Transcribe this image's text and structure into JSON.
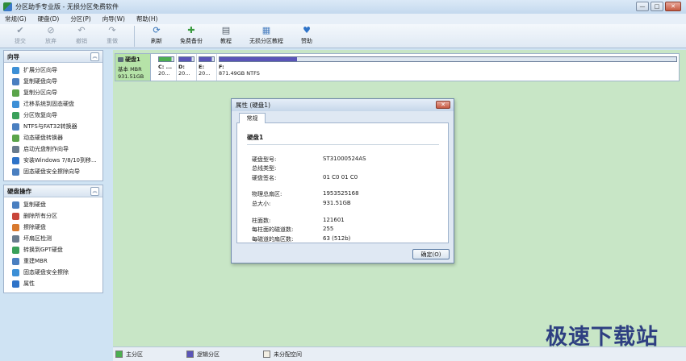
{
  "window": {
    "title": "分区助手专业版 - 无损分区免费软件",
    "buttons": [
      "—",
      "□",
      "✕"
    ]
  },
  "menu": [
    "常规(G)",
    "硬盘(D)",
    "分区(P)",
    "向导(W)",
    "帮助(H)"
  ],
  "toolbar": {
    "group1": [
      {
        "label": "提交",
        "icon": "check-icon",
        "glyph": "✔",
        "disabled": true
      },
      {
        "label": "放弃",
        "icon": "discard-icon",
        "glyph": "⊘",
        "disabled": true
      },
      {
        "label": "撤销",
        "icon": "undo-icon",
        "glyph": "↶",
        "disabled": true
      },
      {
        "label": "重做",
        "icon": "redo-icon",
        "glyph": "↷",
        "disabled": true
      }
    ],
    "group2": [
      {
        "label": "刷新",
        "icon": "refresh-icon",
        "glyph": "⟳",
        "color": "#2f6fb7"
      },
      {
        "label": "免费备份",
        "icon": "backup-icon",
        "glyph": "✚",
        "color": "#3a9a3f"
      },
      {
        "label": "教程",
        "icon": "tutorial-icon",
        "glyph": "▤",
        "color": "#555f6b"
      },
      {
        "label": "无损分区教程",
        "icon": "video-tutorial-icon",
        "glyph": "▦",
        "color": "#4a7fc0"
      },
      {
        "label": "赞助",
        "icon": "heart-icon",
        "glyph": "♥",
        "color": "#2e73c8"
      }
    ]
  },
  "wizard_panel": {
    "title": "向导",
    "items": [
      {
        "label": "扩展分区向导",
        "color": "#3c8fd6"
      },
      {
        "label": "复制硬盘向导",
        "color": "#4a7fc0"
      },
      {
        "label": "复制分区向导",
        "color": "#5aa44a"
      },
      {
        "label": "迁移系统到固态硬盘",
        "color": "#3c8fd6"
      },
      {
        "label": "分区恢复向导",
        "color": "#3aa05a"
      },
      {
        "label": "NTFS与FAT32转换器",
        "color": "#4a7fc0"
      },
      {
        "label": "动态硬盘转换器",
        "color": "#5aa44a"
      },
      {
        "label": "启动光盘制作向导",
        "color": "#6a7c8e"
      },
      {
        "label": "安装Windows 7/8/10到移...",
        "color": "#2e73c8"
      },
      {
        "label": "固态硬盘安全擦除向导",
        "color": "#4a7fc0"
      }
    ]
  },
  "disk_ops_panel": {
    "title": "硬盘操作",
    "items": [
      {
        "label": "复制硬盘",
        "color": "#4a7fc0"
      },
      {
        "label": "删除所有分区",
        "color": "#c8453a"
      },
      {
        "label": "擦除硬盘",
        "color": "#d8792e"
      },
      {
        "label": "坏扇区检测",
        "color": "#6a7c8e"
      },
      {
        "label": "转换到GPT硬盘",
        "color": "#3aa05a"
      },
      {
        "label": "重建MBR",
        "color": "#4a7fc0"
      },
      {
        "label": "固态硬盘安全擦除",
        "color": "#3c8fd6"
      },
      {
        "label": "属性",
        "color": "#2e73c8"
      }
    ]
  },
  "disk": {
    "name": "硬盘1",
    "type": "基本 MBR",
    "size": "931.51GB",
    "partitions": [
      {
        "label": "C: ...",
        "size": "20...",
        "fill": 0.85,
        "color": "#4caf50"
      },
      {
        "label": "D:",
        "size": "20...",
        "fill": 0.85,
        "color": "#5a55b8"
      },
      {
        "label": "E:",
        "size": "20...",
        "fill": 0.85,
        "color": "#5a55b8"
      },
      {
        "label": "F:",
        "size": "871.49GB NTFS",
        "fill": 0.17,
        "color": "#5a55b8"
      }
    ]
  },
  "dialog": {
    "title": "属性 (硬盘1)",
    "tab": "常规",
    "heading": "硬盘1",
    "props": [
      {
        "key": "硬盘型号:",
        "value": "ST31000524AS"
      },
      {
        "key": "总线类型:",
        "value": ""
      },
      {
        "key": "硬盘签名:",
        "value": "01 C0 01 C0"
      },
      {
        "key": "物理总扇区:",
        "value": "1953525168"
      },
      {
        "key": "总大小:",
        "value": "931.51GB"
      },
      {
        "key": "柱面数:",
        "value": "121601"
      },
      {
        "key": "每柱面的磁道数:",
        "value": "255"
      },
      {
        "key": "每磁道的扇区数:",
        "value": "63 (512b)"
      }
    ],
    "ok_label": "确定(O)"
  },
  "legend": [
    {
      "label": "主分区",
      "color": "#4caf50"
    },
    {
      "label": "逻辑分区",
      "color": "#5a55b8"
    },
    {
      "label": "未分配空间",
      "color": "#f3efe3"
    }
  ],
  "watermark": "极速下载站"
}
